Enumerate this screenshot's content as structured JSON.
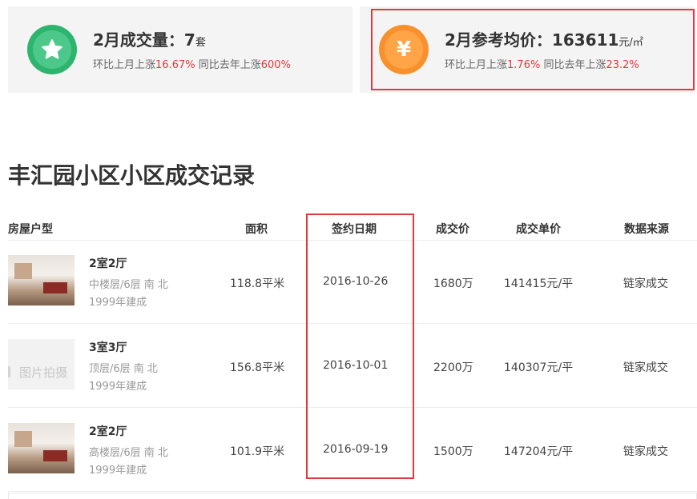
{
  "stats": {
    "volume": {
      "title": "2月成交量：7",
      "unit": "套",
      "mom_text": "环比上月上涨",
      "mom_value": "16.67%",
      "yoy_text": "同比去年上涨",
      "yoy_value": "600%",
      "icon": "star-icon"
    },
    "price": {
      "title": "2月参考均价：163611",
      "unit": "元/㎡",
      "mom_text": "环比上月上涨",
      "mom_value": "1.76%",
      "yoy_text": "同比去年上涨",
      "yoy_value": "23.2%",
      "icon": "yuan-icon",
      "icon_glyph": "¥"
    }
  },
  "section_title": "丰汇园小区小区成交记录",
  "table": {
    "headers": {
      "type": "房屋户型",
      "area": "面积",
      "date": "签约日期",
      "price": "成交价",
      "unit_price": "成交单价",
      "source": "数据来源"
    },
    "rows": [
      {
        "layout": "2室2厅",
        "floor": "中楼层/6层 南 北",
        "built": "1999年建成",
        "area": "118.8平米",
        "date": "2016-10-26",
        "price": "1680万",
        "unit_price": "141415元/平",
        "source": "链家成交"
      },
      {
        "layout": "3室3厅",
        "floor": "顶层/6层 南 北",
        "built": "1999年建成",
        "area": "156.8平米",
        "date": "2016-10-01",
        "price": "2200万",
        "unit_price": "140307元/平",
        "source": "链家成交",
        "placeholder_text": "图片拍摄"
      },
      {
        "layout": "2室2厅",
        "floor": "高楼层/6层 南 北",
        "built": "1999年建成",
        "area": "101.9平米",
        "date": "2016-09-19",
        "price": "1500万",
        "unit_price": "147204元/平",
        "source": "链家成交"
      }
    ]
  },
  "colors": {
    "green": "#2db46f",
    "orange": "#f8912c",
    "red": "#e4393c"
  }
}
